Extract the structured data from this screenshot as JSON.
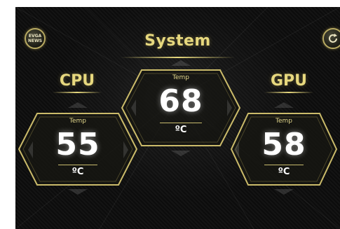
{
  "header": {
    "news_button": "EVGA\nNEWS",
    "title": "System",
    "refresh_icon": "refresh-icon"
  },
  "panels": {
    "cpu": {
      "label": "CPU",
      "temp_label": "Temp",
      "value": "55",
      "unit": "ºC"
    },
    "system": {
      "temp_label": "Temp",
      "value": "68",
      "unit": "ºC"
    },
    "gpu": {
      "label": "GPU",
      "temp_label": "Temp",
      "value": "58",
      "unit": "ºC"
    }
  },
  "colors": {
    "accent": "#e7d87e",
    "background": "#0d0d0d"
  }
}
